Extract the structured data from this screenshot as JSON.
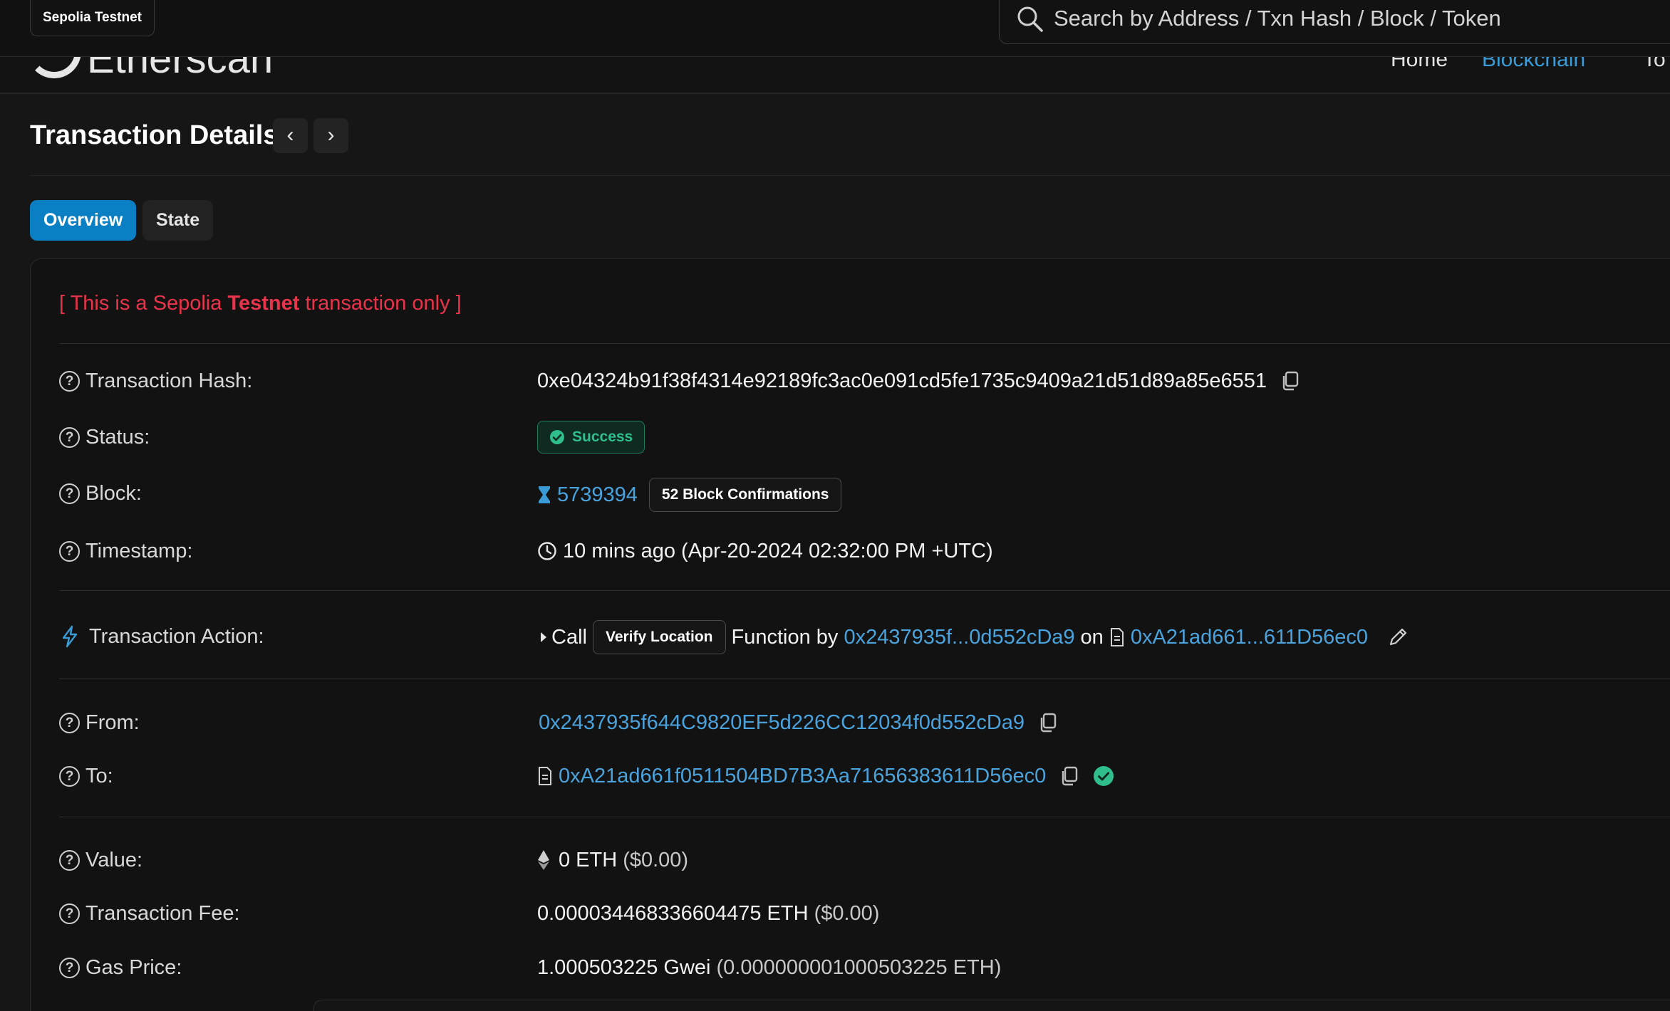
{
  "topbar": {
    "network_badge": "Sepolia Testnet",
    "search_placeholder": "Search by Address / Txn Hash / Block / Token"
  },
  "navbar": {
    "logo_text": "Etherscan",
    "items": [
      "Home",
      "Blockchain",
      "To"
    ]
  },
  "header": {
    "title": "Transaction Details",
    "prev_arrow": "‹",
    "next_arrow": "›"
  },
  "tabs": [
    "Overview",
    "State"
  ],
  "notice": {
    "prefix": "[ This is a Sepolia ",
    "bold": "Testnet",
    "suffix": " transaction only ]"
  },
  "rows": {
    "hash": {
      "label": "Transaction Hash:",
      "value": "0xe04324b91f38f4314e92189fc3ac0e091cd5fe1735c9409a21d51d89a85e6551"
    },
    "status": {
      "label": "Status:",
      "value": "Success"
    },
    "block": {
      "label": "Block:",
      "value": "5739394",
      "confirmations": "52 Block Confirmations"
    },
    "timestamp": {
      "label": "Timestamp:",
      "value": "10 mins ago (Apr-20-2024 02:32:00 PM +UTC)"
    },
    "action": {
      "label": "Transaction Action:",
      "call": "Call",
      "method": "Verify Location",
      "function_by": "Function by",
      "from_short": "0x2437935f...0d552cDa9",
      "on": "on",
      "to_short": "0xA21ad661...611D56ec0"
    },
    "from": {
      "label": "From:",
      "value": "0x2437935f644C9820EF5d226CC12034f0d552cDa9"
    },
    "to": {
      "label": "To:",
      "value": "0xA21ad661f0511504BD7B3Aa71656383611D56ec0"
    },
    "value": {
      "label": "Value:",
      "amount": "0 ETH",
      "usd": "($0.00)"
    },
    "fee": {
      "label": "Transaction Fee:",
      "amount": "0.000034468336604475 ETH",
      "usd": "($0.00)"
    },
    "gas": {
      "label": "Gas Price:",
      "amount": "1.000503225 Gwei",
      "eth": "(0.000000001000503225 ETH)"
    }
  },
  "colors": {
    "accent": "#0b7fc4",
    "link": "#4aa3dc",
    "success": "#2fbf8c",
    "notice_red": "#e8344a",
    "background": "#161616"
  },
  "icons": [
    "search-icon",
    "help-icon",
    "copy-icon",
    "check-circle-icon",
    "hourglass-icon",
    "clock-icon",
    "lightning-icon",
    "caret-right-icon",
    "contract-file-icon",
    "pencil-icon",
    "verified-check-icon",
    "eth-diamond-icon"
  ]
}
